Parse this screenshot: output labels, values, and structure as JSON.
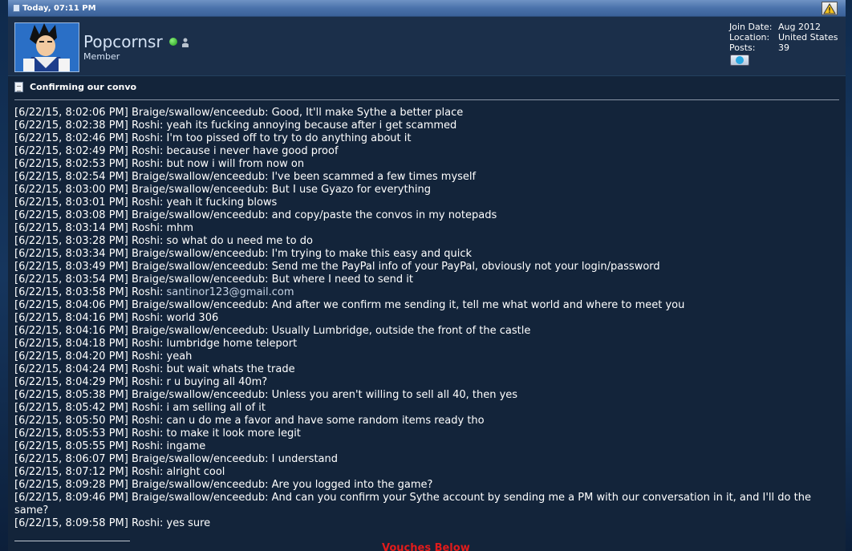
{
  "header": {
    "date": "Today, 07:11 PM"
  },
  "user": {
    "name": "Popcornsr",
    "title": "Member",
    "stats": {
      "join_label": "Join Date:",
      "join_value": "Aug 2012",
      "location_label": "Location:",
      "location_value": "United States",
      "posts_label": "Posts:",
      "posts_value": "39"
    }
  },
  "post": {
    "title": "Confirming our convo",
    "lines": [
      "[6/22/15, 8:02:06 PM] Braige/swallow/enceedub: Good, It'll make Sythe a better place",
      "[6/22/15, 8:02:38 PM] Roshi: yeah its fucking annoying because after i get scammed",
      "[6/22/15, 8:02:46 PM] Roshi: I'm too pissed off to try to do anything about it",
      "[6/22/15, 8:02:49 PM] Roshi: because i never have good proof",
      "[6/22/15, 8:02:53 PM] Roshi: but now i will from now on",
      "[6/22/15, 8:02:54 PM] Braige/swallow/enceedub: I've been scammed a few times myself",
      "[6/22/15, 8:03:00 PM] Braige/swallow/enceedub: But I use Gyazo for everything",
      "[6/22/15, 8:03:01 PM] Roshi: yeah it fucking blows",
      "[6/22/15, 8:03:08 PM] Braige/swallow/enceedub: and copy/paste the convos in my notepads",
      "[6/22/15, 8:03:14 PM] Roshi: mhm",
      "[6/22/15, 8:03:28 PM] Roshi: so what do u need me to do",
      "[6/22/15, 8:03:34 PM] Braige/swallow/enceedub: I'm trying to make this easy and quick",
      "[6/22/15, 8:03:49 PM] Braige/swallow/enceedub: Send me the PayPal info of your PayPal, obviously not your login/password",
      "[6/22/15, 8:03:54 PM] Braige/swallow/enceedub: But where I need to send it"
    ],
    "email_line_prefix": "[6/22/15, 8:03:58 PM] Roshi: ",
    "email": "santinor123@gmail.com",
    "lines2": [
      "[6/22/15, 8:04:06 PM] Braige/swallow/enceedub: And after we confirm me sending it, tell me what world and where to meet you",
      "[6/22/15, 8:04:16 PM] Roshi: world 306",
      "[6/22/15, 8:04:16 PM] Braige/swallow/enceedub: Usually Lumbridge, outside the front of the castle",
      "[6/22/15, 8:04:18 PM] Roshi: lumbridge home teleport",
      "[6/22/15, 8:04:20 PM] Roshi: yeah",
      "[6/22/15, 8:04:24 PM] Roshi: but wait whats the trade",
      "[6/22/15, 8:04:29 PM] Roshi: r u buying all 40m?",
      "[6/22/15, 8:05:38 PM] Braige/swallow/enceedub: Unless you aren't willing to sell all 40, then yes",
      "[6/22/15, 8:05:42 PM] Roshi: i am selling all of it",
      "[6/22/15, 8:05:50 PM] Roshi: can u do me a favor and have some random items ready tho",
      "[6/22/15, 8:05:53 PM] Roshi: to make it look more legit",
      "[6/22/15, 8:05:55 PM] Roshi: ingame",
      "[6/22/15, 8:06:07 PM] Braige/swallow/enceedub: I understand",
      "[6/22/15, 8:07:12 PM] Roshi: alright cool",
      "[6/22/15, 8:09:28 PM] Braige/swallow/enceedub: Are you logged into the game?",
      "[6/22/15, 8:09:46 PM] Braige/swallow/enceedub: And can you confirm your Sythe account by sending me a PM with our conversation in it, and I'll do the same?",
      "[6/22/15, 8:09:58 PM] Roshi: yes sure"
    ],
    "vouches_label": "Vouches Below"
  },
  "colors": {
    "header_bar": "#4a72ab",
    "post_bg": "#13243a",
    "userinfo_bg": "#1b2f4a",
    "text": "#ffffff",
    "vouches": "#e21b1b",
    "online": "#1e9a18"
  },
  "icons": {
    "header": "post-icon",
    "report": "warning-icon",
    "online": "online-status-icon",
    "profile": "person-icon",
    "skype": "skype-icon",
    "title": "document-icon"
  }
}
